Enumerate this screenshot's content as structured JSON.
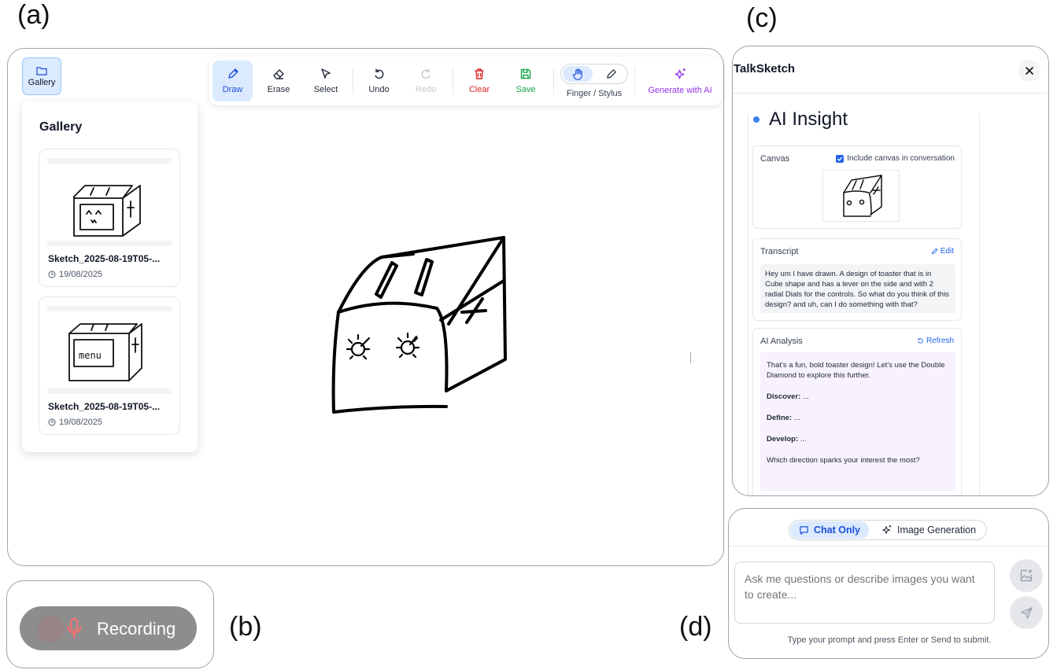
{
  "labels": {
    "a": "(a)",
    "b": "(b)",
    "c": "(c)",
    "d": "(d)"
  },
  "canvas": {
    "gallery_button": "Gallery",
    "toolbar": {
      "draw": "Draw",
      "erase": "Erase",
      "select": "Select",
      "undo": "Undo",
      "redo": "Redo",
      "clear": "Clear",
      "save": "Save",
      "input_mode": "Finger / Stylus",
      "generate": "Generate with AI"
    },
    "gallery": {
      "title": "Gallery",
      "items": [
        {
          "name": "Sketch_2025-08-19T05-...",
          "date": "19/08/2025"
        },
        {
          "name": "Sketch_2025-08-19T05-...",
          "date": "19/08/2025",
          "thumb_text": "menu"
        }
      ]
    }
  },
  "recording": {
    "label": "Recording"
  },
  "insight": {
    "app_title": "TalkSketch",
    "title": "AI Insight",
    "canvas_section": {
      "heading": "Canvas",
      "include_label": "Include canvas in conversation",
      "include_checked": true
    },
    "transcript": {
      "heading": "Transcript",
      "edit": "Edit",
      "text": "Hey um I have drawn. A design of toaster that is in Cube shape and has a lever on the side and with 2 radial Dials for the controls. So what do you think of this design? and uh, can I do something with that?"
    },
    "analysis": {
      "heading": "AI Analysis",
      "refresh": "Refresh",
      "intro": "That's a fun, bold toaster design! Let's use the Double Diamond to explore this further.",
      "discover_label": "Discover:",
      "discover_text": " ...",
      "define_label": "Define:",
      "define_text": " ...",
      "develop_label": "Develop:",
      "develop_text": " ...",
      "closing": "Which direction sparks your interest the most?"
    }
  },
  "chat": {
    "tabs": {
      "chat_only": "Chat Only",
      "image_generation": "Image Generation",
      "active": "chat_only"
    },
    "input_placeholder": "Ask me questions or describe images you want to create...",
    "hint": "Type your prompt and press Enter or Send to submit."
  },
  "colors": {
    "accent": "#2563eb",
    "active_bg": "#dbeafe",
    "clear": "#dc2626",
    "save": "#16a34a",
    "generate": "#9333ea",
    "analysis_bg": "#f7f2fe"
  }
}
